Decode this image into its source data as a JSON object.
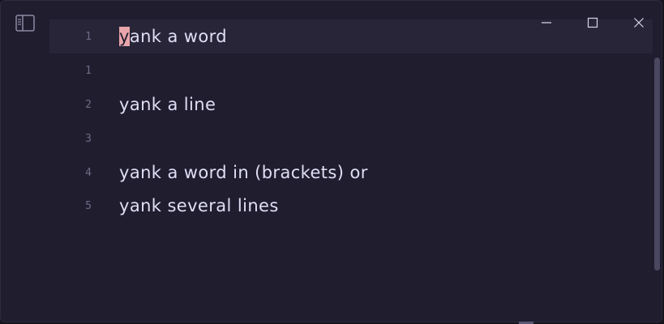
{
  "colors": {
    "background": "#1f1d2e",
    "current_line": "#272537",
    "text": "#e0def4",
    "line_number": "#6f6c85",
    "cursor": "#e8a5ac"
  },
  "toolbar": {
    "sidebar_toggle_icon": "sidebar-panel-icon"
  },
  "window_controls": {
    "minimize_icon": "minimize-icon",
    "maximize_icon": "maximize-icon",
    "close_icon": "close-icon"
  },
  "editor": {
    "lines": [
      {
        "number": "1",
        "cursor_char": "y",
        "text": "ank a word",
        "current": true
      },
      {
        "number": "1",
        "text": ""
      },
      {
        "number": "2",
        "text": "yank a line"
      },
      {
        "number": "3",
        "text": ""
      },
      {
        "number": "4",
        "text": "yank a word in (brackets) or"
      },
      {
        "number": "5",
        "text": "yank several lines"
      }
    ]
  }
}
